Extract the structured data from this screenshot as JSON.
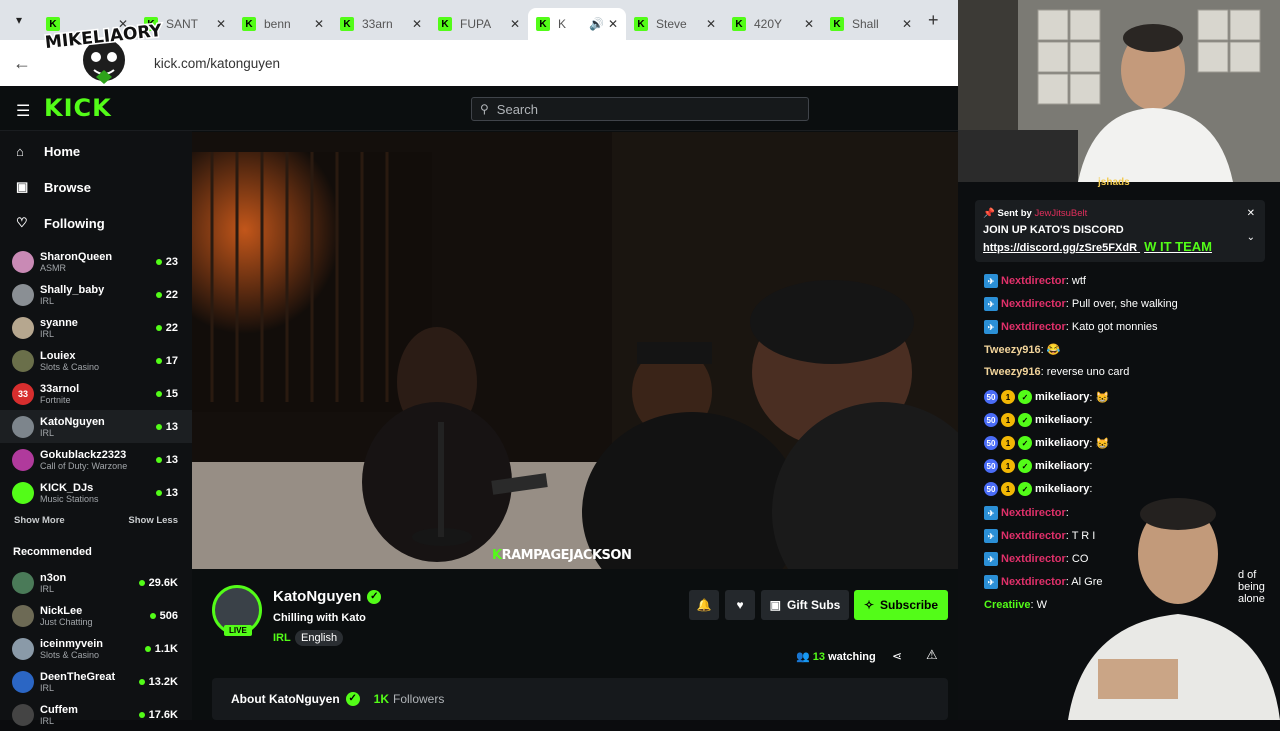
{
  "browser": {
    "tabs": [
      {
        "title": ""
      },
      {
        "title": "SANT"
      },
      {
        "title": "benn"
      },
      {
        "title": "33arn"
      },
      {
        "title": "FUPA"
      },
      {
        "title": "K"
      },
      {
        "title": "Steve"
      },
      {
        "title": "420Y"
      },
      {
        "title": "Shall"
      }
    ],
    "url": "kick.com/katonguyen"
  },
  "overlay_logo_text": "MIKELIAORY",
  "site": {
    "logo": "KICK",
    "search_placeholder": "Search"
  },
  "nav": [
    {
      "label": "Home",
      "icon": "home-icon"
    },
    {
      "label": "Browse",
      "icon": "browse-icon"
    },
    {
      "label": "Following",
      "icon": "heart-icon"
    }
  ],
  "following": [
    {
      "name": "SharonQueen",
      "category": "ASMR",
      "viewers": "23",
      "color": "#c98ab5"
    },
    {
      "name": "Shally_baby",
      "category": "IRL",
      "viewers": "22",
      "color": "#8a8f94"
    },
    {
      "name": "syanne",
      "category": "IRL",
      "viewers": "22",
      "color": "#b6a78f"
    },
    {
      "name": "Louiex",
      "category": "Slots & Casino",
      "viewers": "17",
      "color": "#6a6f4a"
    },
    {
      "name": "33arnol",
      "category": "Fortnite",
      "viewers": "15",
      "color": "#d72e2e",
      "initials": "33"
    },
    {
      "name": "KatoNguyen",
      "category": "IRL",
      "viewers": "13",
      "color": "#7d858c"
    },
    {
      "name": "Gokublackz2323",
      "category": "Call of Duty: Warzone",
      "viewers": "13",
      "color": "#b03a9c"
    },
    {
      "name": "KICK_DJs",
      "category": "Music Stations",
      "viewers": "13",
      "color": "#53fc18"
    }
  ],
  "show_more": "Show More",
  "show_less": "Show Less",
  "recommended_title": "Recommended",
  "recommended": [
    {
      "name": "n3on",
      "category": "IRL",
      "viewers": "29.6K",
      "color": "#4a7a58"
    },
    {
      "name": "NickLee",
      "category": "Just Chatting",
      "viewers": "506",
      "color": "#6d6a55"
    },
    {
      "name": "iceinmyvein",
      "category": "Slots & Casino",
      "viewers": "1.1K",
      "color": "#8a9aa8"
    },
    {
      "name": "DeenTheGreat",
      "category": "IRL",
      "viewers": "13.2K",
      "color": "#2b66c4"
    },
    {
      "name": "Cuffem",
      "category": "IRL",
      "viewers": "17.6K",
      "color": "#444"
    }
  ],
  "video": {
    "caption_k": "K",
    "caption": "RAMPAGEJACKSON"
  },
  "streamer": {
    "name": "KatoNguyen",
    "live": "LIVE",
    "title": "Chilling with Kato",
    "category": "IRL",
    "language": "English",
    "gift_subs": "Gift Subs",
    "subscribe": "Subscribe",
    "watching_count": "13",
    "watching_label": "watching",
    "about": "About KatoNguyen",
    "followers_count": "1K",
    "followers_label": "Followers"
  },
  "chat": {
    "top_user": "jshads",
    "pinned": {
      "sent_by": "Sent by",
      "sender": "JewJitsuBelt",
      "message": "JOIN UP KATO'S DISCORD",
      "link": "https://discord.gg/zSre5FXdR",
      "emote_text": "W IT TEAM"
    },
    "messages": [
      {
        "user": "Nextdirector",
        "text": ": wtf",
        "color": "#e0306a",
        "badges": [
          "pro"
        ]
      },
      {
        "user": "Nextdirector",
        "text": ": Pull over, she walking",
        "color": "#e0306a",
        "badges": [
          "pro"
        ]
      },
      {
        "user": "Nextdirector",
        "text": ": Kato got monnies",
        "color": "#e0306a",
        "badges": [
          "pro"
        ]
      },
      {
        "user": "Tweezy916",
        "text": ": 😂",
        "color": "#f2d49b",
        "badges": []
      },
      {
        "user": "Tweezy916",
        "text": ": reverse uno card",
        "color": "#f2d49b",
        "badges": []
      },
      {
        "user": "mikeliaory",
        "text": ": 😸",
        "color": "#ffffff",
        "badges": [
          "50",
          "1",
          "v"
        ]
      },
      {
        "user": "mikeliaory",
        "text": ": ",
        "color": "#ffffff",
        "badges": [
          "50",
          "1",
          "v"
        ]
      },
      {
        "user": "mikeliaory",
        "text": ": 😸",
        "color": "#ffffff",
        "badges": [
          "50",
          "1",
          "v"
        ]
      },
      {
        "user": "mikeliaory",
        "text": ": ",
        "color": "#ffffff",
        "badges": [
          "50",
          "1",
          "v"
        ]
      },
      {
        "user": "mikeliaory",
        "text": ": ",
        "color": "#ffffff",
        "badges": [
          "50",
          "1",
          "v"
        ]
      },
      {
        "user": "Nextdirector",
        "text": ": ",
        "color": "#e0306a",
        "badges": [
          "pro"
        ]
      },
      {
        "user": "Nextdirector",
        "text": ": T R I",
        "color": "#e0306a",
        "badges": [
          "pro"
        ]
      },
      {
        "user": "Nextdirector",
        "text": ": CO",
        "color": "#e0306a",
        "badges": [
          "pro"
        ]
      },
      {
        "user": "Nextdirector",
        "text": ": Al Gre",
        "color": "#e0306a",
        "badges": [
          "pro"
        ]
      },
      {
        "user": "Creatiive",
        "text": ": W",
        "color": "#53fc18",
        "badges": []
      }
    ],
    "partial_tail": "d of being alone"
  },
  "colors": {
    "accent": "#53fc18",
    "bg": "#0b0e0f"
  }
}
